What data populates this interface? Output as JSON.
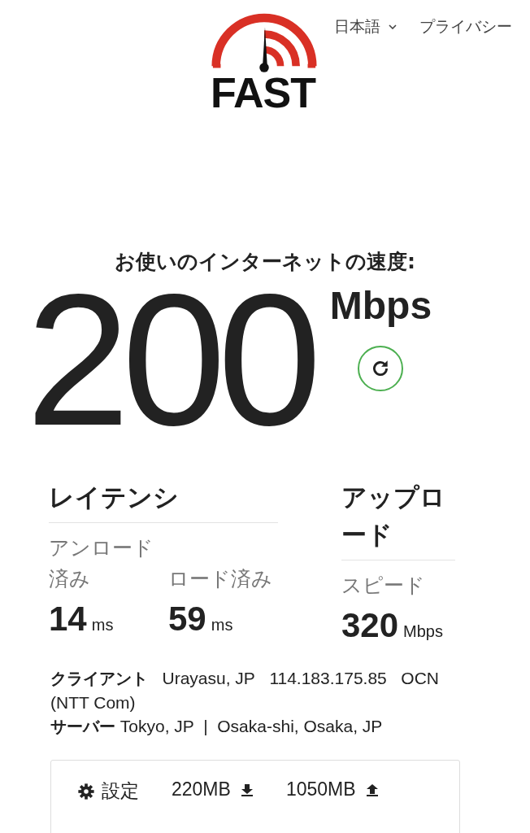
{
  "header": {
    "logo": "FAST",
    "language": "日本語",
    "privacy": "プライバシー"
  },
  "speed": {
    "caption": "お使いのインターネットの速度:",
    "value": "200",
    "unit": "Mbps"
  },
  "latency": {
    "title": "レイテンシ",
    "metrics": [
      {
        "label": "アンロード済み",
        "value": "14",
        "unit": "ms"
      },
      {
        "label": "ロード済み",
        "value": "59",
        "unit": "ms"
      }
    ]
  },
  "upload": {
    "title": "アップロード",
    "label": "スピード",
    "value": "320",
    "unit": "Mbps"
  },
  "client": {
    "label": "クライアント",
    "location": "Urayasu, JP",
    "ip": "114.183.175.85",
    "isp": "OCN (NTT Com)"
  },
  "server": {
    "label": "サーバー",
    "locations": "Tokyo, JP  |  Osaka-shi, Osaka, JP"
  },
  "settings": {
    "label": "設定",
    "download": "220MB",
    "upload": "1050MB"
  }
}
